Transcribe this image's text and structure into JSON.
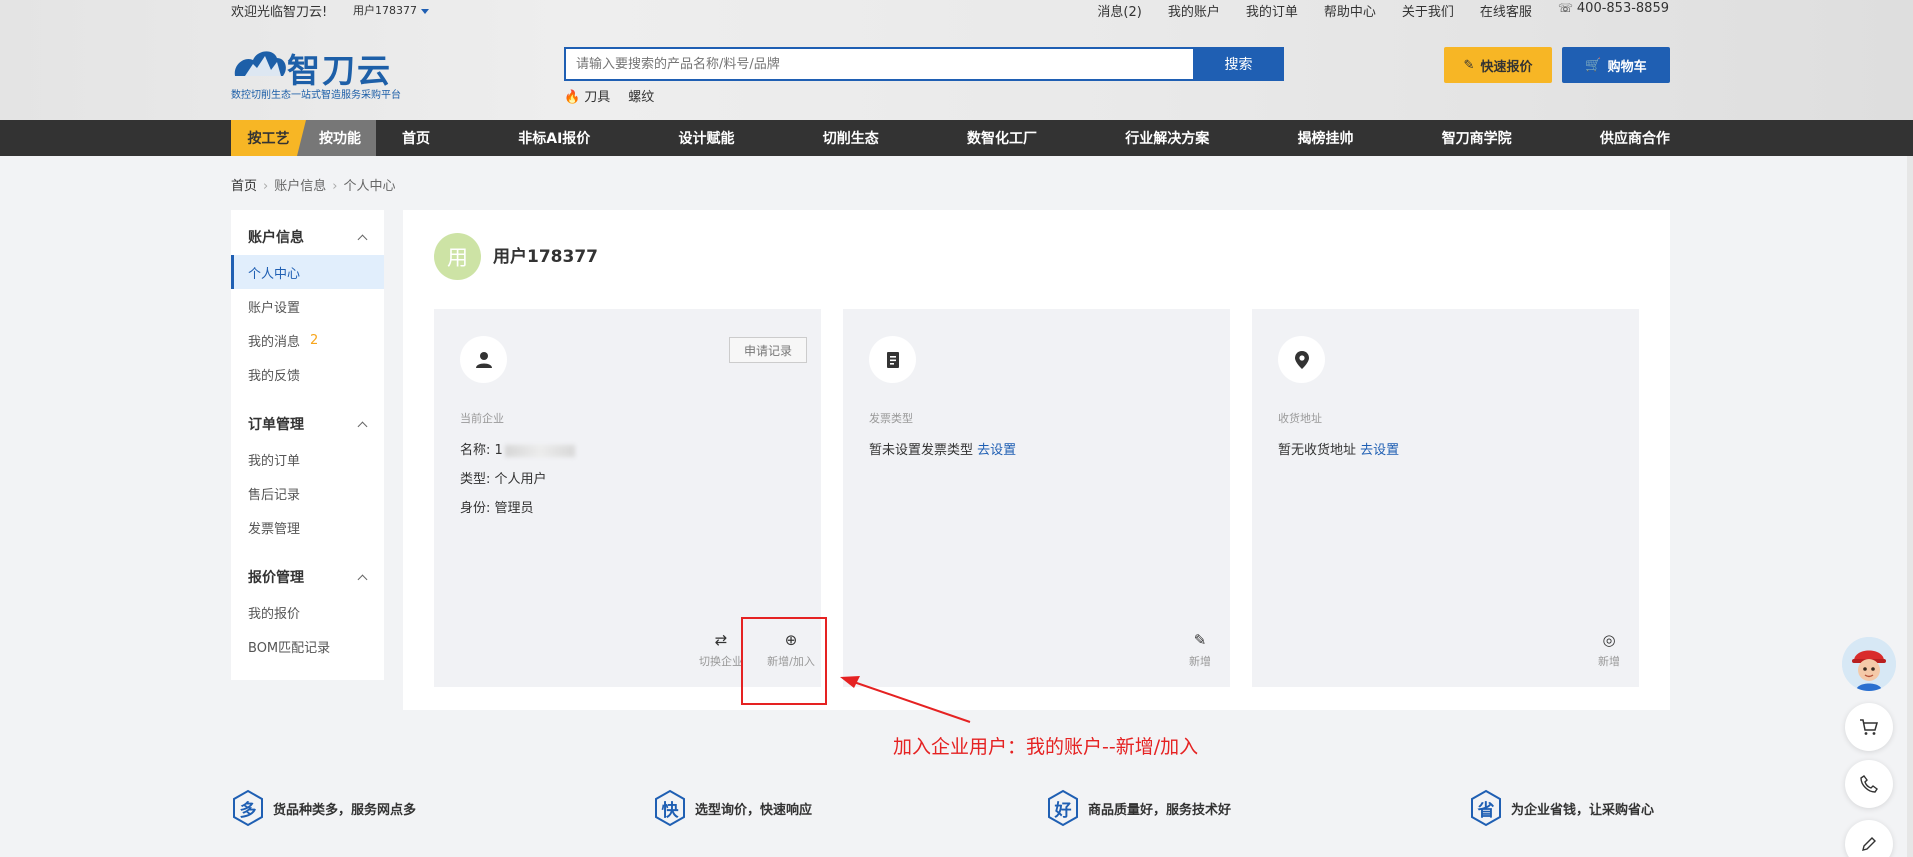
{
  "topbar": {
    "welcome": "欢迎光临智刀云!",
    "user": "用户178377",
    "links": [
      "消息(2)",
      "我的账户",
      "我的订单",
      "帮助中心",
      "关于我们",
      "在线客服"
    ],
    "phone": "400-853-8859"
  },
  "logo": {
    "name": "智刀云",
    "slogan": "数控切削生态一站式智造服务采购平台"
  },
  "search": {
    "placeholder": "请输入要搜索的产品名称/料号/品牌",
    "button": "搜索",
    "hotwords": [
      "刀具",
      "螺纹"
    ]
  },
  "actions": {
    "quick_quote": "快速报价",
    "cart": "购物车"
  },
  "nav": {
    "tab_process": "按工艺",
    "tab_function": "按功能",
    "items": [
      "首页",
      "非标AI报价",
      "设计赋能",
      "切削生态",
      "数智化工厂",
      "行业解决方案",
      "揭榜挂帅",
      "智刀商学院",
      "供应商合作"
    ]
  },
  "breadcrumb": [
    "首页",
    "账户信息",
    "个人中心"
  ],
  "sidebar": {
    "groups": [
      {
        "title": "账户信息",
        "items": [
          "个人中心",
          "账户设置",
          "我的消息",
          "我的反馈"
        ]
      },
      {
        "title": "订单管理",
        "items": [
          "我的订单",
          "售后记录",
          "发票管理"
        ]
      },
      {
        "title": "报价管理",
        "items": [
          "我的报价",
          "BOM匹配记录"
        ]
      }
    ],
    "message_badge": "2"
  },
  "profile": {
    "avatar_char": "用",
    "username": "用户178377"
  },
  "cards": {
    "enterprise": {
      "title": "当前企业",
      "apply_button": "申请记录",
      "name_label": "名称:",
      "name_value": "1",
      "type_label": "类型:",
      "type_value": "个人用户",
      "role_label": "身份:",
      "role_value": "管理员",
      "switch_label": "切换企业",
      "add_label": "新增/加入"
    },
    "invoice": {
      "title": "发票类型",
      "text": "暂未设置发票类型",
      "link": "去设置",
      "action": "新增"
    },
    "address": {
      "title": "收货地址",
      "text": "暂无收货地址",
      "link": "去设置",
      "action": "新增"
    }
  },
  "annotation": "加入企业用户：我的账户--新增/加入",
  "features": [
    {
      "char": "多",
      "text": "货品种类多，服务网点多"
    },
    {
      "char": "快",
      "text": "选型询价，快速响应"
    },
    {
      "char": "好",
      "text": "商品质量好，服务技术好"
    },
    {
      "char": "省",
      "text": "为企业省钱，让采购省心"
    }
  ],
  "colors": {
    "brand_blue": "#1f5fb3",
    "accent_yellow": "#f7b625",
    "annotation_red": "#e52222",
    "nav_dark": "#333333"
  }
}
